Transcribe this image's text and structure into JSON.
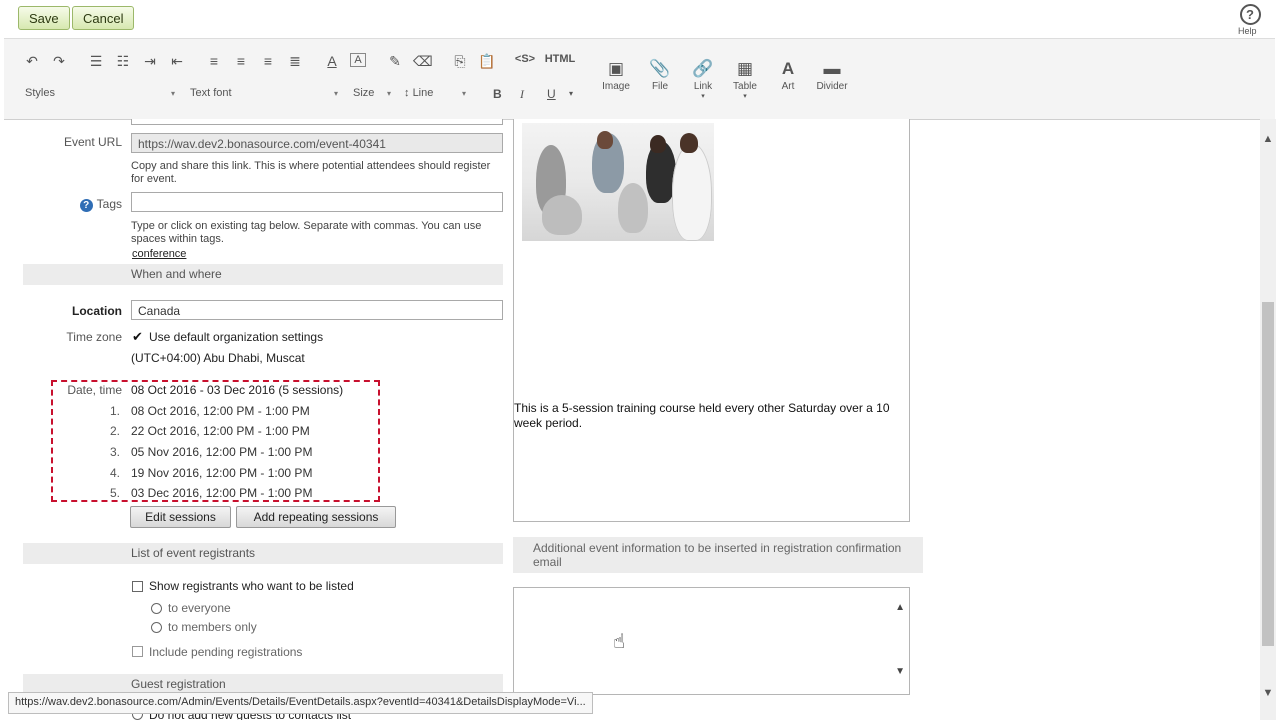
{
  "top": {
    "save": "Save",
    "cancel": "Cancel",
    "help": "Help"
  },
  "toolbar": {
    "styles": "Styles",
    "text_font": "Text font",
    "size": "Size",
    "line": "Line",
    "html": "HTML",
    "image": "Image",
    "file": "File",
    "link": "Link",
    "table": "Table",
    "art": "Art",
    "divider": "Divider"
  },
  "form": {
    "event_url_label": "Event URL",
    "event_url_value": "https://wav.dev2.bonasource.com/event-40341",
    "event_url_help": "Copy and share this link. This is where potential attendees should register for event.",
    "tags_label": "Tags",
    "tags_value": "",
    "tags_help": "Type or click on existing tag below. Separate with commas. You can use spaces within tags.",
    "tag_link": "conference",
    "when_where": "When and where",
    "location_label": "Location",
    "location_value": "Canada",
    "timezone_label": "Time zone",
    "timezone_checkbox": "Use default organization settings",
    "timezone_value": "(UTC+04:00) Abu Dhabi, Muscat",
    "datetime_label": "Date, time",
    "datetime_summary": "08 Oct 2016 - 03 Dec 2016 (5 sessions)",
    "sessions": [
      {
        "n": "1.",
        "v": "08 Oct 2016, 12:00 PM - 1:00 PM"
      },
      {
        "n": "2.",
        "v": "22 Oct 2016, 12:00 PM - 1:00 PM"
      },
      {
        "n": "3.",
        "v": "05 Nov 2016, 12:00 PM - 1:00 PM"
      },
      {
        "n": "4.",
        "v": "19 Nov 2016, 12:00 PM - 1:00 PM"
      },
      {
        "n": "5.",
        "v": "03 Dec 2016, 12:00 PM - 1:00 PM"
      }
    ],
    "edit_sessions": "Edit sessions",
    "add_repeating": "Add repeating sessions",
    "registrants_hdr": "List of event registrants",
    "show_registrants": "Show registrants who want to be listed",
    "to_everyone": "to everyone",
    "to_members": "to members only",
    "include_pending": "Include pending registrations",
    "guest_hdr": "Guest registration",
    "guest_option": "Do not add new guests to contacts list"
  },
  "description": {
    "text": "This is a 5-session training course held every other Saturday over a 10 week period.",
    "additional_hdr": "Additional event information to be inserted in registration confirmation email"
  },
  "statusbar": "https://wav.dev2.bonasource.com/Admin/Events/Details/EventDetails.aspx?eventId=40341&DetailsDisplayMode=Vi..."
}
